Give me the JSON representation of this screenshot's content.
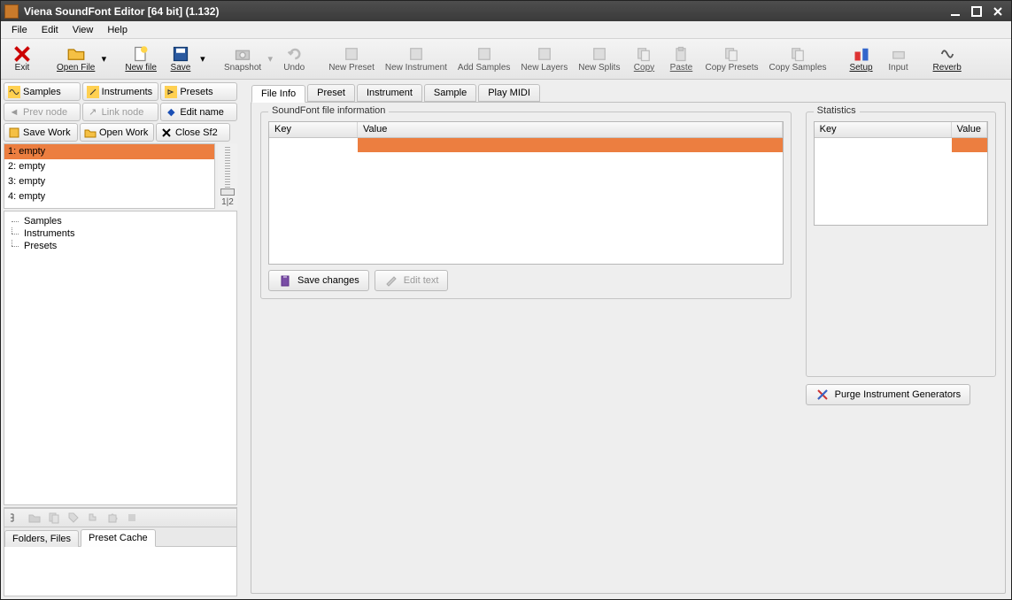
{
  "window": {
    "title": "Viena SoundFont Editor [64 bit] (1.132)"
  },
  "menu": {
    "file": "File",
    "edit": "Edit",
    "view": "View",
    "help": "Help"
  },
  "toolbar": {
    "exit": "Exit",
    "open": "Open File",
    "newfile": "New file",
    "save": "Save",
    "snapshot": "Snapshot",
    "undo": "Undo",
    "newpreset": "New Preset",
    "newinstr": "New Instrument",
    "addsamples": "Add Samples",
    "newlayers": "New Layers",
    "newsplits": "New Splits",
    "copy": "Copy",
    "paste": "Paste",
    "copypresets": "Copy Presets",
    "copysamples": "Copy Samples",
    "setup": "Setup",
    "input": "Input",
    "reverb": "Reverb"
  },
  "sidebar": {
    "samples": "Samples",
    "instruments": "Instruments",
    "presets": "Presets",
    "prevnode": "Prev node",
    "linknode": "Link node",
    "editname": "Edit name",
    "savework": "Save Work",
    "openwork": "Open Work",
    "closesf2": "Close Sf2"
  },
  "filelist": [
    {
      "label": "1: empty",
      "selected": true
    },
    {
      "label": "2: empty",
      "selected": false
    },
    {
      "label": "3: empty",
      "selected": false
    },
    {
      "label": "4: empty",
      "selected": false
    }
  ],
  "slider_label": "1|2",
  "tree": {
    "samples": "Samples",
    "instruments": "Instruments",
    "presets": "Presets"
  },
  "bottom_tabs": {
    "folders": "Folders, Files",
    "cache": "Preset Cache"
  },
  "tabs": {
    "fileinfo": "File Info",
    "preset": "Preset",
    "instrument": "Instrument",
    "sample": "Sample",
    "playmidi": "Play MIDI"
  },
  "fileinfo": {
    "legend": "SoundFont file information",
    "col_key": "Key",
    "col_val": "Value",
    "save_changes": "Save changes",
    "edit_text": "Edit text"
  },
  "stats": {
    "legend": "Statistics",
    "col_key": "Key",
    "col_val": "Value",
    "purge": "Purge Instrument Generators"
  }
}
